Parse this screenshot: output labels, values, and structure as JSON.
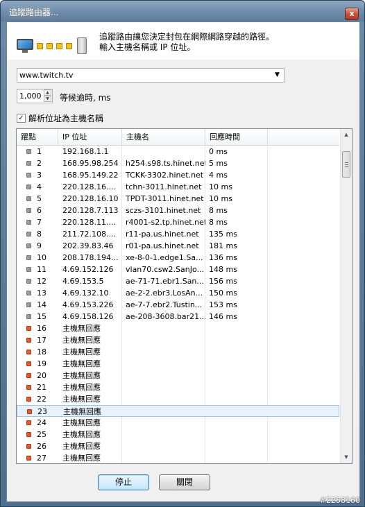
{
  "window": {
    "title": "追蹤路由器...",
    "close_label": "x"
  },
  "header": {
    "line1": "追蹤路由讓您決定封包在網際網路穿越的路徑。",
    "line2": "輸入主機名稱或 IP 位址。"
  },
  "host_input": {
    "value": "www.twitch.tv"
  },
  "timeout": {
    "value": "1,000",
    "label": "等候逾時, ms"
  },
  "resolve": {
    "checked": true,
    "label": "解析位址為主機名稱"
  },
  "table": {
    "columns": [
      "躍點",
      "IP 位址",
      "主機名",
      "回應時間"
    ],
    "selected_hop": "23",
    "rows": [
      {
        "hop": "1",
        "ip": "192.168.1.1",
        "host": "",
        "time": "0 ms",
        "status": "ok"
      },
      {
        "hop": "2",
        "ip": "168.95.98.254",
        "host": "h254.s98.ts.hinet.net",
        "time": "5 ms",
        "status": "ok"
      },
      {
        "hop": "3",
        "ip": "168.95.149.22",
        "host": "TCKK-3302.hinet.net",
        "time": "4 ms",
        "status": "ok"
      },
      {
        "hop": "4",
        "ip": "220.128.16....",
        "host": "tchn-3011.hinet.net",
        "time": "10 ms",
        "status": "ok"
      },
      {
        "hop": "5",
        "ip": "220.128.16.10",
        "host": "TPDT-3011.hinet.net",
        "time": "10 ms",
        "status": "ok"
      },
      {
        "hop": "6",
        "ip": "220.128.7.113",
        "host": "sczs-3101.hinet.net",
        "time": "8 ms",
        "status": "ok"
      },
      {
        "hop": "7",
        "ip": "220.128.11....",
        "host": "r4001-s2.tp.hinet.net",
        "time": "8 ms",
        "status": "ok"
      },
      {
        "hop": "8",
        "ip": "211.72.108....",
        "host": "r11-pa.us.hinet.net",
        "time": "135 ms",
        "status": "ok"
      },
      {
        "hop": "9",
        "ip": "202.39.83.46",
        "host": "r01-pa.us.hinet.net",
        "time": "181 ms",
        "status": "ok"
      },
      {
        "hop": "10",
        "ip": "208.178.194...",
        "host": "xe-8-0-1.edge1.Sa...",
        "time": "136 ms",
        "status": "ok"
      },
      {
        "hop": "11",
        "ip": "4.69.152.126",
        "host": "vlan70.csw2.SanJo...",
        "time": "148 ms",
        "status": "ok"
      },
      {
        "hop": "12",
        "ip": "4.69.153.5",
        "host": "ae-71-71.ebr1.San...",
        "time": "156 ms",
        "status": "ok"
      },
      {
        "hop": "13",
        "ip": "4.69.132.10",
        "host": "ae-2-2.ebr3.LosAn...",
        "time": "150 ms",
        "status": "ok"
      },
      {
        "hop": "14",
        "ip": "4.69.153.226",
        "host": "ae-7-7.ebr2.Tustin...",
        "time": "153 ms",
        "status": "ok"
      },
      {
        "hop": "15",
        "ip": "4.69.158.126",
        "host": "ae-208-3608.bar21...",
        "time": "146 ms",
        "status": "ok"
      },
      {
        "hop": "16",
        "ip": "主機無回應",
        "host": "",
        "time": "",
        "status": "fail"
      },
      {
        "hop": "17",
        "ip": "主機無回應",
        "host": "",
        "time": "",
        "status": "fail"
      },
      {
        "hop": "18",
        "ip": "主機無回應",
        "host": "",
        "time": "",
        "status": "fail"
      },
      {
        "hop": "19",
        "ip": "主機無回應",
        "host": "",
        "time": "",
        "status": "fail"
      },
      {
        "hop": "20",
        "ip": "主機無回應",
        "host": "",
        "time": "",
        "status": "fail"
      },
      {
        "hop": "21",
        "ip": "主機無回應",
        "host": "",
        "time": "",
        "status": "fail"
      },
      {
        "hop": "22",
        "ip": "主機無回應",
        "host": "",
        "time": "",
        "status": "fail"
      },
      {
        "hop": "23",
        "ip": "主機無回應",
        "host": "",
        "time": "",
        "status": "fail"
      },
      {
        "hop": "24",
        "ip": "主機無回應",
        "host": "",
        "time": "",
        "status": "fail"
      },
      {
        "hop": "25",
        "ip": "主機無回應",
        "host": "",
        "time": "",
        "status": "fail"
      },
      {
        "hop": "26",
        "ip": "主機無回應",
        "host": "",
        "time": "",
        "status": "fail"
      },
      {
        "hop": "27",
        "ip": "主機無回應",
        "host": "",
        "time": "",
        "status": "fail"
      }
    ]
  },
  "buttons": {
    "stop": "停止",
    "close": "關閉"
  },
  "watermark": "#2258160",
  "colors": {
    "ok_marker": "#9a9a9a",
    "fail_marker": "#e85a2a",
    "selection": "#e8f2fd"
  }
}
